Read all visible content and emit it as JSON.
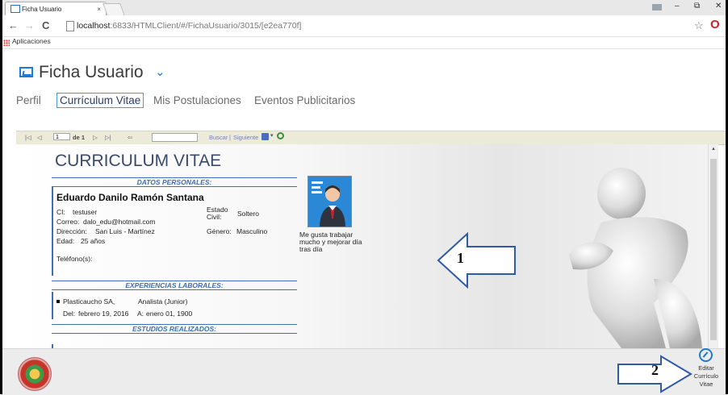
{
  "browser": {
    "tab_title": "Ficha Usuario",
    "tab_close": "×",
    "url_host": "localhost",
    "url_path": ":6833/HTMLClient/#/FichaUsuario/3015/[e2ea770f]",
    "bookmarks_label": "Aplicaciones",
    "back": "←",
    "forward": "→",
    "reload": "C",
    "star": "☆",
    "opera": "O"
  },
  "app": {
    "title": "Ficha Usuario",
    "title_chevron": "⌄",
    "tabs": [
      {
        "label": "Perfil",
        "active": false
      },
      {
        "label": "Currículum Vitae",
        "active": true
      },
      {
        "label": "Mis Postulaciones",
        "active": false
      },
      {
        "label": "Eventos Publicitarios",
        "active": false
      }
    ]
  },
  "report_toolbar": {
    "first": "|◁",
    "prev": "◁",
    "page_value": "1",
    "of_label": "de 1",
    "next": "▷",
    "last": "▷|",
    "back_parent": "⇦",
    "find_label": "Buscar",
    "separator": "|",
    "next_label": "Siguiente"
  },
  "cv": {
    "title": "CURRICULUM VITAE",
    "section_personal": "DATOS PERSONALES:",
    "full_name": "Eduardo Danilo Ramón Santana",
    "fields": {
      "ci_label": "CI:",
      "ci_value": "testuser",
      "email_label": "Correo:",
      "email_value": "dalo_edu@hotmail.com",
      "address_label": "Dirección:",
      "address_value": "San Luis - Martínez",
      "age_label": "Edad:",
      "age_value": "25 años",
      "phone_label": "Teléfono(s):",
      "civil_label": "Estado Civil:",
      "civil_value": "Soltero",
      "gender_label": "Género:",
      "gender_value": "Masculino"
    },
    "motto": "Me gusta trabajar mucho y mejorar día tras día",
    "section_experience": "EXPERIENCIAS LABORALES:",
    "experience": {
      "company": "Plasticaucho SA,",
      "position": "Analista (Junior)",
      "from_label": "Del:",
      "from_value": "febrero 19, 2016",
      "to_label": "A:",
      "to_value": "enero 01, 1900"
    },
    "section_studies": "ESTUDIOS REALIZADOS:"
  },
  "annotations": {
    "arrow1_label": "1",
    "arrow2_label": "2"
  },
  "footer": {
    "edit_line1": "Editar",
    "edit_line2": "Currículo",
    "edit_line3": "Vitae"
  },
  "colors": {
    "accent": "#1e7bd0",
    "section_blue": "#3a6fb5",
    "toolbar_bg": "#ecead8",
    "footer_bg": "#ececec"
  }
}
